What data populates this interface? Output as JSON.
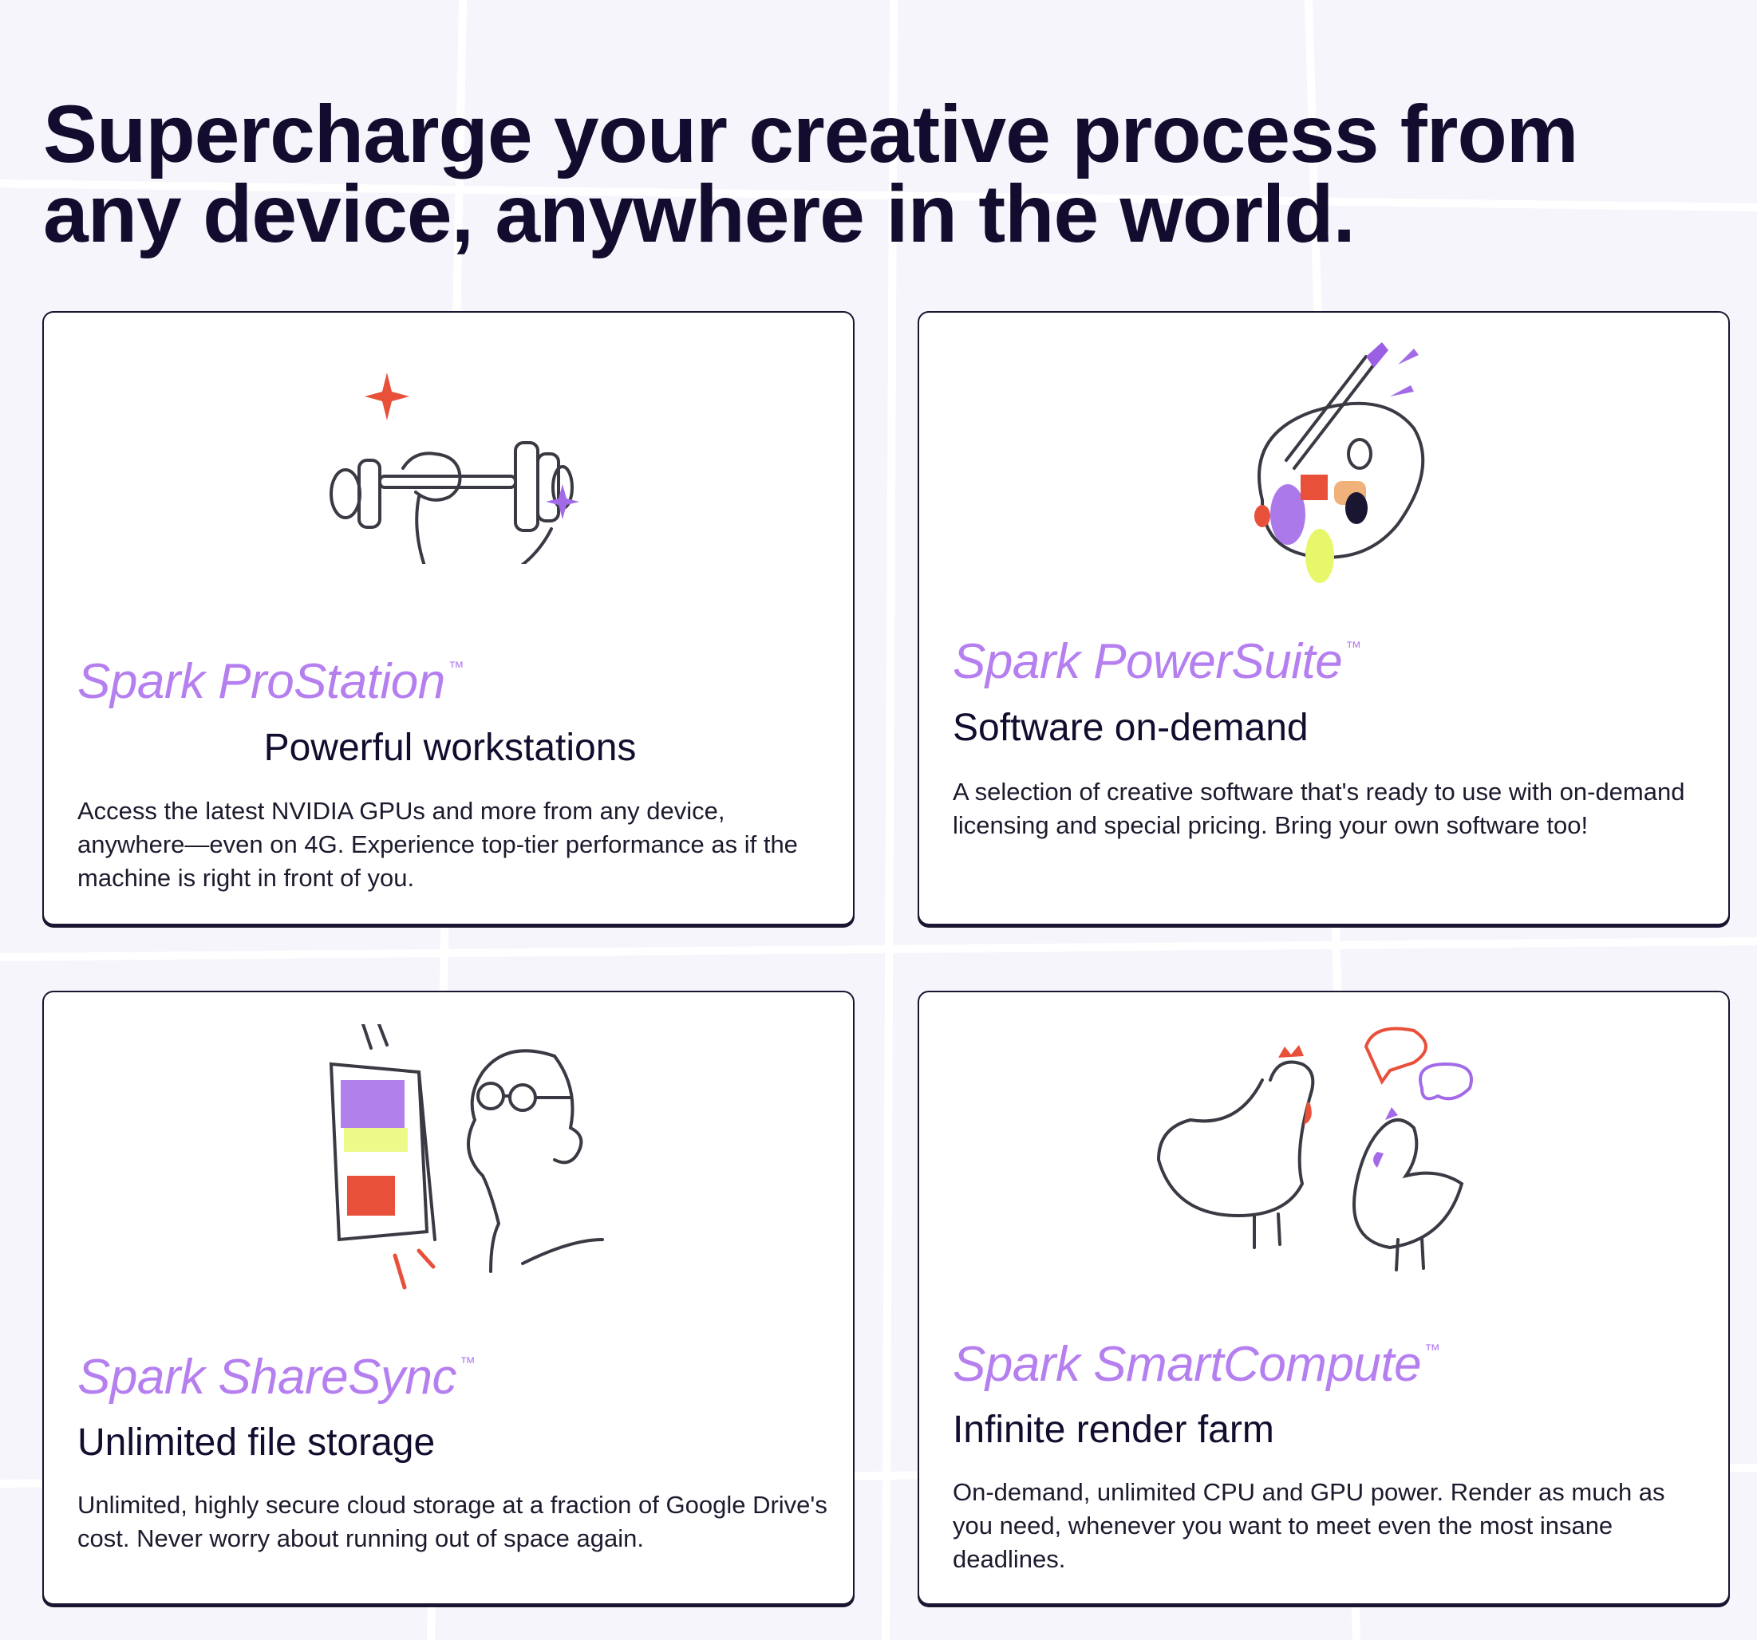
{
  "page": {
    "headline": "Supercharge your creative process from any device, anywhere in the world.",
    "accent_color": "#b57ff0",
    "text_color": "#140c2e"
  },
  "cards": [
    {
      "brand": "Spark ProStation",
      "trademark": "™",
      "subtitle": "Powerful workstations",
      "description": "Access the latest NVIDIA GPUs and more from any device, anywhere—even on 4G. Experience top-tier performance as if the machine is right in front of you.",
      "illustration": "dumbbell-arm-icon"
    },
    {
      "brand": "Spark PowerSuite",
      "trademark": "™",
      "subtitle": "Software on-demand",
      "description": "A selection of creative software that's ready to use with on-demand licensing and special pricing. Bring your own software too!",
      "illustration": "paint-palette-icon"
    },
    {
      "brand": "Spark ShareSync",
      "trademark": "™",
      "subtitle": "Unlimited file storage",
      "description": "Unlimited, highly secure cloud storage at a fraction of Google Drive's cost. Never worry about running out of space again.",
      "illustration": "person-at-monitor-icon"
    },
    {
      "brand": "Spark SmartCompute",
      "trademark": "™",
      "subtitle": "Infinite render farm",
      "description": "On-demand, unlimited CPU and GPU power. Render as much as you need, whenever you want to meet even the most insane deadlines.",
      "illustration": "chickens-icon"
    }
  ]
}
